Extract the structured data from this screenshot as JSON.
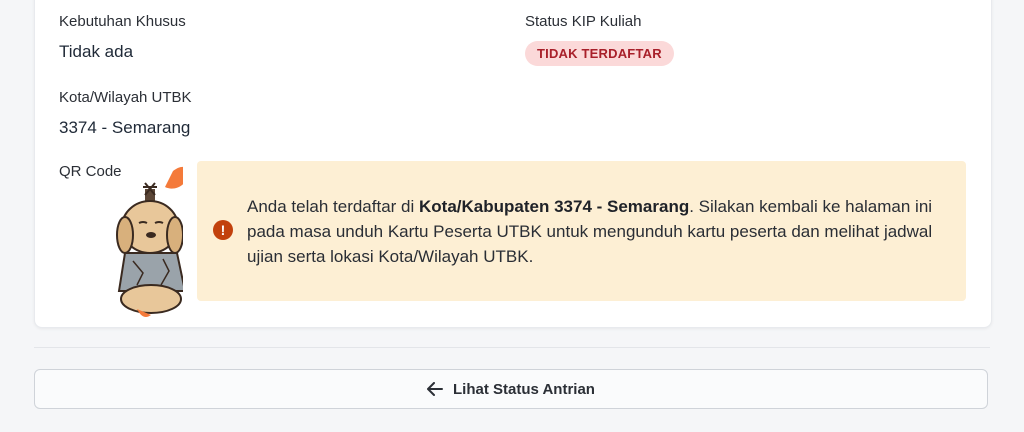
{
  "fields": {
    "special_needs": {
      "label": "Kebutuhan Khusus",
      "value": "Tidak ada"
    },
    "kip_status": {
      "label": "Status KIP Kuliah",
      "badge": "TIDAK TERDAFTAR"
    },
    "utbk_city": {
      "label": "Kota/Wilayah UTBK",
      "value": "3374 - Semarang"
    },
    "qr_code": {
      "label": "QR Code"
    }
  },
  "alert": {
    "icon": "exclamation-icon",
    "text_before": "Anda telah terdaftar di ",
    "text_bold": "Kota/Kabupaten 3374 - Semarang",
    "text_after": ". Silakan kembali ke halaman ini pada masa unduh Kartu Peserta UTBK untuk mengunduh kartu peserta dan melihat jadwal ujian serta lokasi Kota/Wilayah UTBK."
  },
  "button": {
    "label": "Lihat Status Antrian",
    "icon": "arrow-left-icon"
  },
  "colors": {
    "badge_bg": "#fbd9d9",
    "badge_text": "#a8202a",
    "alert_bg": "#fdefd4",
    "alert_icon": "#c2410c"
  }
}
